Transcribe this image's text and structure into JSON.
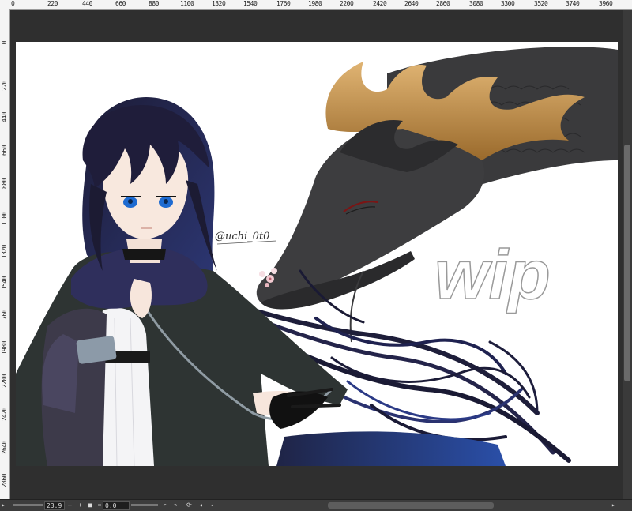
{
  "ruler": {
    "top_labels": [
      "0",
      "220",
      "440",
      "660",
      "880",
      "1100",
      "1320",
      "1540",
      "1760",
      "1980",
      "2200",
      "2420",
      "2640",
      "2860",
      "3080",
      "3300",
      "3520",
      "3740",
      "3960"
    ],
    "left_labels": [
      "0",
      "220",
      "440",
      "660",
      "880",
      "1100",
      "1320",
      "1540",
      "1760",
      "1980",
      "2200",
      "2420",
      "2640",
      "2860"
    ]
  },
  "artwork": {
    "signature": "@uchi_0t0",
    "wip_text": "wip"
  },
  "statusbar": {
    "zoom": "23.9",
    "rotation": "0.0",
    "minus": "–",
    "plus": "+"
  },
  "colors": {
    "hair": "#1b1a33",
    "cloak": "#2e3332",
    "dragon": "#3b3b3d",
    "flame": "#c99b5a",
    "eye": "#1e6bd1"
  }
}
